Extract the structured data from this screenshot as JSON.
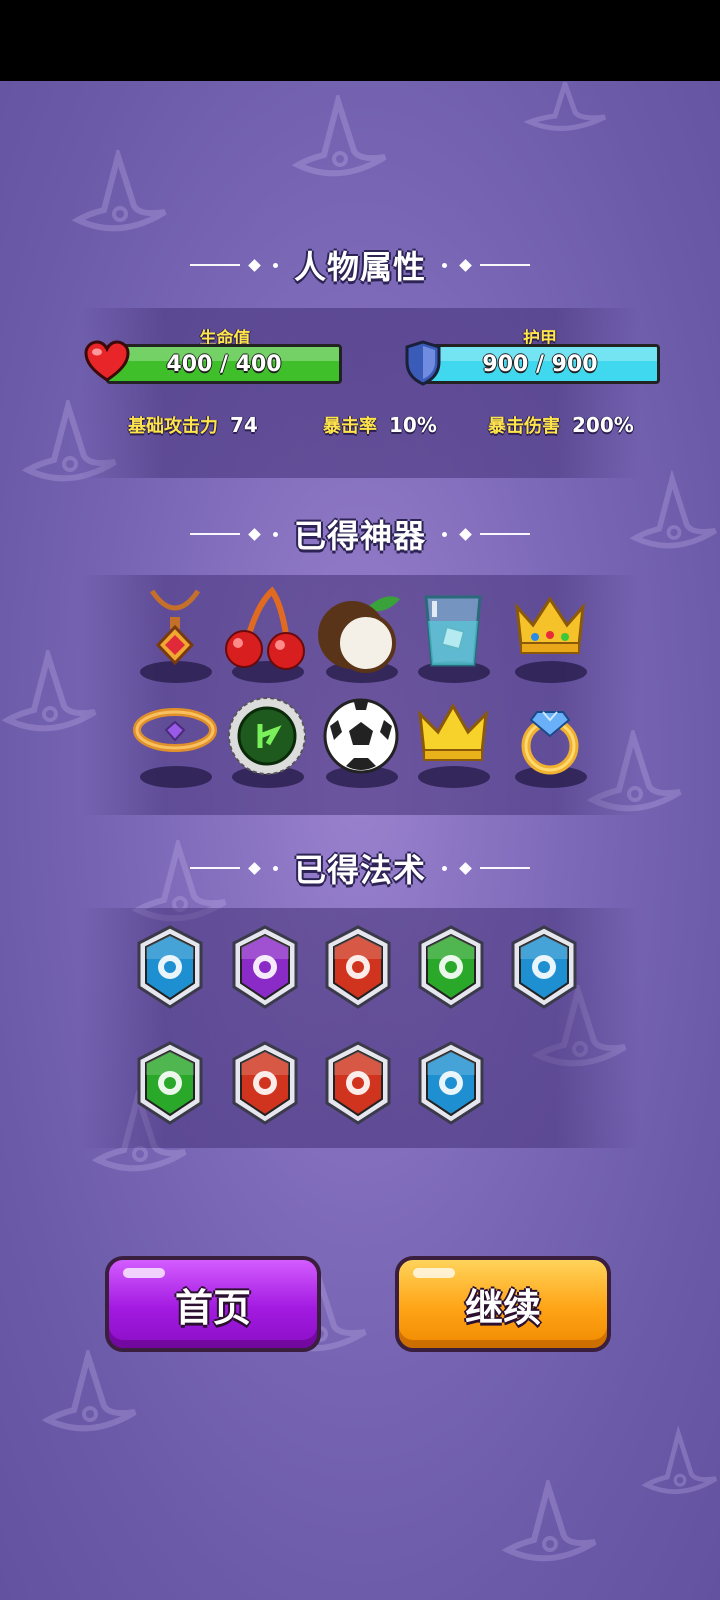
{
  "sections": {
    "attributes_title": "人物属性",
    "artifacts_title": "已得神器",
    "spells_title": "已得法术"
  },
  "hp": {
    "label": "生命值",
    "value": "400 / 400",
    "fill": 1.0,
    "color": "#3fbf2a"
  },
  "armor": {
    "label": "护甲",
    "value": "900 / 900",
    "fill": 1.0,
    "color": "#3fd8ee"
  },
  "stats": [
    {
      "label": "基础攻击力",
      "value": "74"
    },
    {
      "label": "暴击率",
      "value": "10%"
    },
    {
      "label": "暴击伤害",
      "value": "200%"
    }
  ],
  "artifacts": [
    "pendant-necklace-icon",
    "cherries-icon",
    "coconut-icon",
    "ice-water-glass-icon",
    "jeweled-crown-icon",
    "gem-bracelet-icon",
    "spiked-gear-icon",
    "soccer-ball-icon",
    "gold-crown-icon",
    "diamond-ring-icon"
  ],
  "spells": [
    {
      "icon": "boot-shield-icon",
      "color": "#1e8fd0"
    },
    {
      "icon": "thermometer-shield-icon",
      "color": "#8a2bc8"
    },
    {
      "icon": "fire-burst-shield-icon",
      "color": "#d0341e"
    },
    {
      "icon": "fast-forward-shield-icon",
      "color": "#2aa82a"
    },
    {
      "icon": "cross-shield-icon",
      "color": "#1e8fd0"
    },
    {
      "icon": "poison-burst-shield-icon",
      "color": "#2aa82a"
    },
    {
      "icon": "flame-ring-shield-icon",
      "color": "#d0341e"
    },
    {
      "icon": "fireball-shield-icon",
      "color": "#d0341e"
    },
    {
      "icon": "frost-burst-shield-icon",
      "color": "#1e8fd0"
    }
  ],
  "buttons": {
    "home": "首页",
    "continue": "继续"
  }
}
